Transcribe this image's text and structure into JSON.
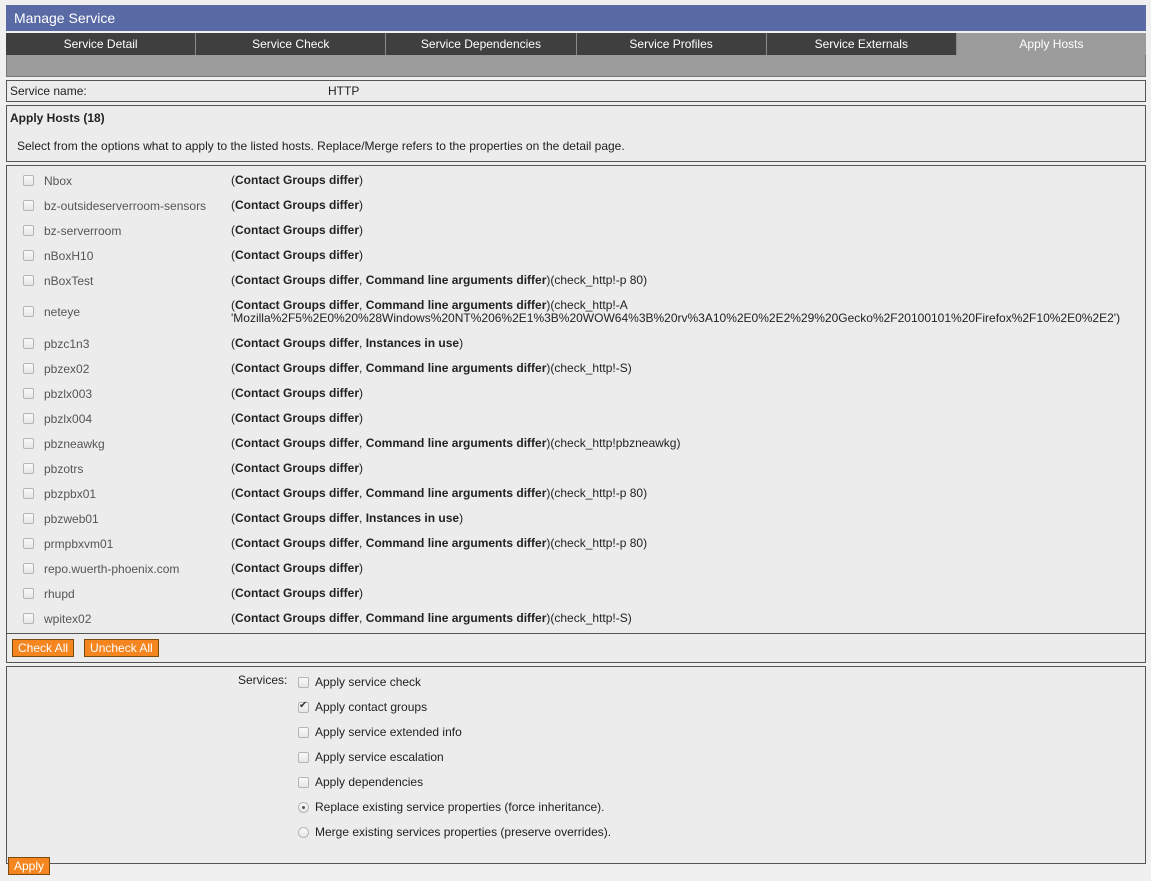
{
  "header": {
    "title": "Manage Service"
  },
  "tabs": [
    {
      "label": "Service Detail",
      "active": false
    },
    {
      "label": "Service Check",
      "active": false
    },
    {
      "label": "Service Dependencies",
      "active": false
    },
    {
      "label": "Service Profiles",
      "active": false
    },
    {
      "label": "Service Externals",
      "active": false
    },
    {
      "label": "Apply Hosts",
      "active": true
    }
  ],
  "service": {
    "label": "Service name:",
    "value": "HTTP"
  },
  "apply": {
    "title": "Apply Hosts (18)",
    "description": "Select from the options what to apply to the listed hosts. Replace/Merge refers to the properties on the detail page."
  },
  "hosts": [
    {
      "name": "Nbox",
      "info": [
        "Contact Groups differ"
      ],
      "extra": ""
    },
    {
      "name": "bz-outsideserverroom-sensors",
      "info": [
        "Contact Groups differ"
      ],
      "extra": ""
    },
    {
      "name": "bz-serverroom",
      "info": [
        "Contact Groups differ"
      ],
      "extra": ""
    },
    {
      "name": "nBoxH10",
      "info": [
        "Contact Groups differ"
      ],
      "extra": ""
    },
    {
      "name": "nBoxTest",
      "info": [
        "Contact Groups differ",
        "Command line arguments differ"
      ],
      "extra": "(check_http!-p 80)"
    },
    {
      "name": "neteye",
      "info": [
        "Contact Groups differ",
        "Command line arguments differ"
      ],
      "extra": "(check_http!-A",
      "extra2": "'Mozilla%2F5%2E0%20%28Windows%20NT%206%2E1%3B%20WOW64%3B%20rv%3A10%2E0%2E2%29%20Gecko%2F20100101%20Firefox%2F10%2E0%2E2')"
    },
    {
      "name": "pbzc1n3",
      "info": [
        "Contact Groups differ",
        "Instances in use"
      ],
      "extra": ""
    },
    {
      "name": "pbzex02",
      "info": [
        "Contact Groups differ",
        "Command line arguments differ"
      ],
      "extra": "(check_http!-S)"
    },
    {
      "name": "pbzlx003",
      "info": [
        "Contact Groups differ"
      ],
      "extra": ""
    },
    {
      "name": "pbzlx004",
      "info": [
        "Contact Groups differ"
      ],
      "extra": ""
    },
    {
      "name": "pbzneawkg",
      "info": [
        "Contact Groups differ",
        "Command line arguments differ"
      ],
      "extra": "(check_http!pbzneawkg)"
    },
    {
      "name": "pbzotrs",
      "info": [
        "Contact Groups differ"
      ],
      "extra": ""
    },
    {
      "name": "pbzpbx01",
      "info": [
        "Contact Groups differ",
        "Command line arguments differ"
      ],
      "extra": "(check_http!-p 80)"
    },
    {
      "name": "pbzweb01",
      "info": [
        "Contact Groups differ",
        "Instances in use"
      ],
      "extra": ""
    },
    {
      "name": "prmpbxvm01",
      "info": [
        "Contact Groups differ",
        "Command line arguments differ"
      ],
      "extra": "(check_http!-p 80)"
    },
    {
      "name": "repo.wuerth-phoenix.com",
      "info": [
        "Contact Groups differ"
      ],
      "extra": ""
    },
    {
      "name": "rhupd",
      "info": [
        "Contact Groups differ"
      ],
      "extra": ""
    },
    {
      "name": "wpitex02",
      "info": [
        "Contact Groups differ",
        "Command line arguments differ"
      ],
      "extra": "(check_http!-S)"
    }
  ],
  "buttons": {
    "check_all": "Check All",
    "uncheck_all": "Uncheck All",
    "apply": "Apply"
  },
  "services": {
    "label": "Services:",
    "options": [
      {
        "type": "checkbox",
        "label": "Apply service check",
        "checked": false
      },
      {
        "type": "checkbox",
        "label": "Apply contact groups",
        "checked": true
      },
      {
        "type": "checkbox",
        "label": "Apply service extended info",
        "checked": false
      },
      {
        "type": "checkbox",
        "label": "Apply service escalation",
        "checked": false
      },
      {
        "type": "checkbox",
        "label": "Apply dependencies",
        "checked": false
      },
      {
        "type": "radio",
        "label": "Replace existing service properties (force inheritance).",
        "checked": true
      },
      {
        "type": "radio",
        "label": "Merge existing services properties (preserve overrides).",
        "checked": false
      }
    ]
  },
  "colors": {
    "title_bg": "#5a6aa5",
    "tab_bg": "#3f3f3f",
    "tab_active": "#9b9b9b",
    "button": "#f5851f"
  }
}
